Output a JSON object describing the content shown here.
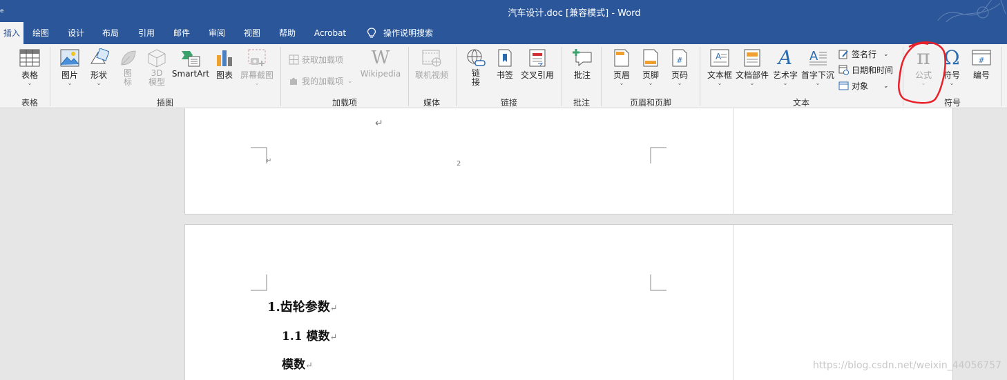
{
  "window": {
    "title": "汽车设计.doc [兼容模式]  -  Word",
    "left_stub": "ₑ"
  },
  "tabs": [
    {
      "label": "插入"
    },
    {
      "label": "绘图"
    },
    {
      "label": "设计"
    },
    {
      "label": "布局"
    },
    {
      "label": "引用"
    },
    {
      "label": "邮件"
    },
    {
      "label": "审阅"
    },
    {
      "label": "视图"
    },
    {
      "label": "帮助"
    },
    {
      "label": "Acrobat"
    },
    {
      "label": "操作说明搜索"
    }
  ],
  "ribbon": {
    "groups": {
      "tables": "表格",
      "illustrations": "插图",
      "addins": "加载项",
      "media": "媒体",
      "links": "链接",
      "comments": "批注",
      "header_footer": "页眉和页脚",
      "text": "文本",
      "symbols": "符号"
    },
    "buttons": {
      "table": "表格",
      "pictures": "图片",
      "shapes": "形状",
      "icons_1": "图",
      "icons_2": "标",
      "model3d_1": "3D",
      "model3d_2": "模型",
      "smartart": "SmartArt",
      "chart": "图表",
      "screenshot": "屏幕截图",
      "get_addins": "获取加载项",
      "my_addins": "我的加载项",
      "wikipedia": "Wikipedia",
      "online_video": "联机视频",
      "link_1": "链",
      "link_2": "接",
      "bookmark": "书签",
      "cross_ref": "交叉引用",
      "comment": "批注",
      "header": "页眉",
      "footer": "页脚",
      "page_number": "页码",
      "textbox": "文本框",
      "quick_parts": "文档部件",
      "wordart": "艺术字",
      "dropcap": "首字下沉",
      "signature": "签名行",
      "datetime": "日期和时间",
      "object": "对象",
      "equation": "公式",
      "symbol": "符号",
      "numbering": "编号"
    }
  },
  "document": {
    "page1_footer_number": "2",
    "heading1": "1.齿轮参数",
    "heading2": "1.1 模数",
    "body_bold": "模数",
    "para_mark": "↵"
  },
  "watermark": "https://blog.csdn.net/weixin_44056757",
  "colors": {
    "accent": "#2b579a",
    "ribbon_bg": "#f3f3f3",
    "annotation_red": "#e8202a"
  }
}
